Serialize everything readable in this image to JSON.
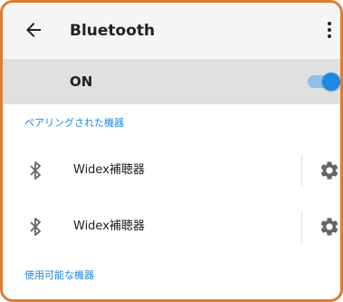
{
  "header": {
    "title": "Bluetooth",
    "back_icon": "arrow-back-icon",
    "more_icon": "more-vertical-icon"
  },
  "bluetooth_toggle": {
    "label": "ON",
    "enabled": true,
    "accent_color": "#1e88e5"
  },
  "paired_section": {
    "header": "ペアリングされた機器",
    "devices": [
      {
        "name": "Widex補聴器",
        "icon": "bluetooth-icon",
        "settings_icon": "gear-icon"
      },
      {
        "name": "Widex補聴器",
        "icon": "bluetooth-icon",
        "settings_icon": "gear-icon"
      }
    ]
  },
  "available_section": {
    "header": "使用可能な機器"
  }
}
